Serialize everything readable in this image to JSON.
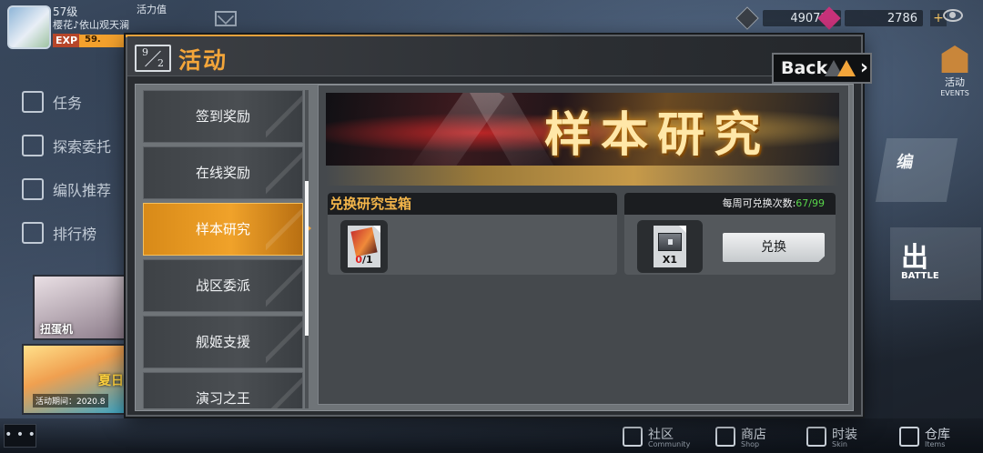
{
  "hud": {
    "level": "57级",
    "player_name": "樱花♪依山观天澜",
    "exp_label": "EXP",
    "exp_value": "59.",
    "stamina_label": "活力值",
    "currency_1": "490720",
    "currency_2": "2786",
    "plus_label": "+"
  },
  "side_menu": {
    "items": [
      {
        "label": "任务"
      },
      {
        "label": "探索委托"
      },
      {
        "label": "编队推荐"
      },
      {
        "label": "排行榜"
      }
    ],
    "gacha_label": "扭蛋机",
    "summer_title": "夏日",
    "summer_date": "活动期间：2020.8"
  },
  "right_panel": {
    "events_label": "活动",
    "events_en": "EVENTS",
    "formation_label": "编",
    "sortie_label": "出",
    "sortie_en": "BATTLE"
  },
  "bottom_nav": {
    "chat": "• • •",
    "items": [
      {
        "label": "社区",
        "en": "Community"
      },
      {
        "label": "商店",
        "en": "Shop"
      },
      {
        "label": "时装",
        "en": "Skin"
      },
      {
        "label": "仓库",
        "en": "Items"
      }
    ]
  },
  "dialog": {
    "icon_top": "9",
    "icon_bottom": "2",
    "title": "活动",
    "back_label": "Back",
    "back_chevron": "›",
    "tabs": [
      {
        "label": "签到奖励"
      },
      {
        "label": "在线奖励"
      },
      {
        "label": "样本研究"
      },
      {
        "label": "战区委派"
      },
      {
        "label": "舰姬支援"
      },
      {
        "label": "演习之王"
      }
    ],
    "active_tab_index": 2,
    "banner_title": "样本研究",
    "exchange_panel": {
      "title": "兑换研究宝箱",
      "item_have": "0",
      "item_need": "/1"
    },
    "reward_panel": {
      "weekly_label": "每周可兑换次数:",
      "weekly_count": "67/99",
      "box_qty": "X1",
      "button_label": "兑换"
    }
  },
  "colors": {
    "accent_orange": "#f3a53a",
    "active_tab": "#f0a22a",
    "count_green": "#58d64a",
    "count_red": "#e02020"
  }
}
